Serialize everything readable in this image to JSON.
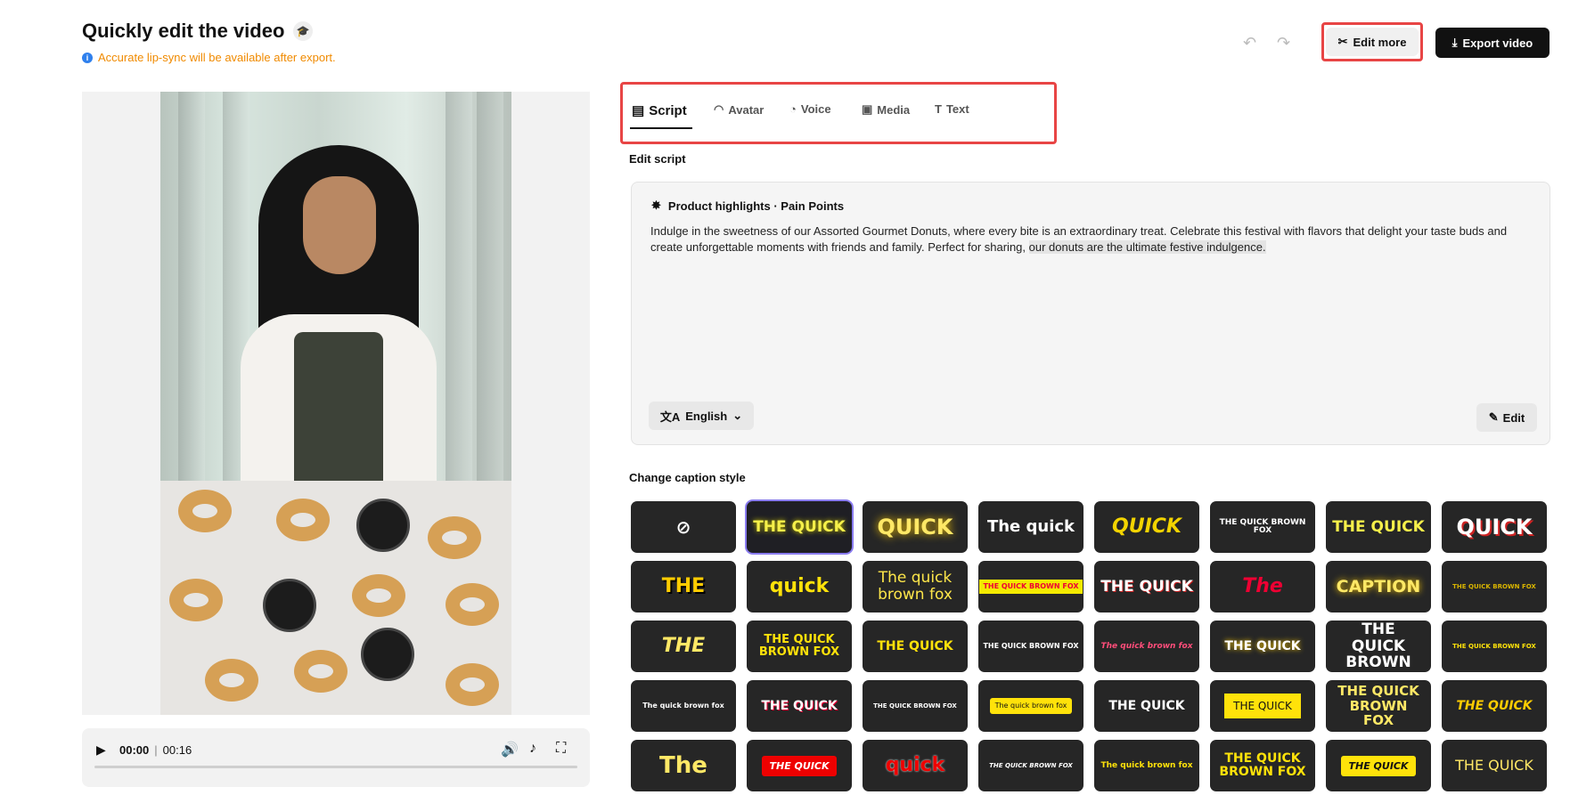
{
  "header": {
    "title": "Quickly edit the video",
    "notice": "Accurate lip-sync will be available after export.",
    "edit_more": "Edit more",
    "export": "Export video"
  },
  "player": {
    "current": "00:00",
    "separator": "|",
    "duration": "00:16"
  },
  "tabs": [
    {
      "label": "Script",
      "icon": "script-icon",
      "active": true
    },
    {
      "label": "Avatar",
      "icon": "avatar-icon"
    },
    {
      "label": "Voice",
      "icon": "voice-icon"
    },
    {
      "label": "Media",
      "icon": "media-icon"
    },
    {
      "label": "Text",
      "icon": "text-icon"
    }
  ],
  "script": {
    "section_label": "Edit script",
    "heading": "Product highlights · Pain Points",
    "text_main": "Indulge in the sweetness of our Assorted Gourmet Donuts, where every bite is an extraordinary treat. Celebrate this festival with flavors that delight your taste buds and create unforgettable moments with friends and family. Perfect for sharing, ",
    "text_highlight": "our donuts are the ultimate festive indulgence.",
    "language": "English",
    "edit": "Edit"
  },
  "captions": {
    "label": "Change caption style",
    "styles": [
      {
        "text": "⊘"
      },
      {
        "text": "THE QUICK"
      },
      {
        "text": "QUICK"
      },
      {
        "text": "The quick"
      },
      {
        "text": "QUICK"
      },
      {
        "text": "THE QUICK BROWN FOX"
      },
      {
        "text": "THE QUICK"
      },
      {
        "text": "QUICK"
      },
      {
        "text": "THE"
      },
      {
        "text": "quick"
      },
      {
        "text": "The quick brown fox"
      },
      {
        "text": "THE QUICK BROWN FOX"
      },
      {
        "text": "THE QUICK"
      },
      {
        "text": "The"
      },
      {
        "text": "CAPTION"
      },
      {
        "text": "THE QUICK BROWN FOX"
      },
      {
        "text": "THE"
      },
      {
        "text": "THE QUICK BROWN FOX"
      },
      {
        "text": "THE QUICK"
      },
      {
        "text": "THE QUICK BROWN FOX"
      },
      {
        "text": "The quick brown fox"
      },
      {
        "text": "THE QUICK"
      },
      {
        "text": "THE QUICK BROWN"
      },
      {
        "text": "THE QUICK BROWN FOX"
      },
      {
        "text": "The quick brown fox"
      },
      {
        "text": "THE QUICK"
      },
      {
        "text": "THE QUICK BROWN FOX"
      },
      {
        "text": "The quick brown fox"
      },
      {
        "text": "THE QUICK"
      },
      {
        "text": "THE QUICK"
      },
      {
        "text": "THE QUICK BROWN FOX"
      },
      {
        "text": "THE QUICK"
      },
      {
        "text": "The"
      },
      {
        "text": "THE QUICK"
      },
      {
        "text": "quick"
      },
      {
        "text": "THE QUICK BROWN FOX"
      },
      {
        "text": "The quick brown fox"
      },
      {
        "text": "THE QUICK BROWN FOX"
      },
      {
        "text": "THE QUICK"
      },
      {
        "text": "THE QUICK"
      }
    ]
  }
}
